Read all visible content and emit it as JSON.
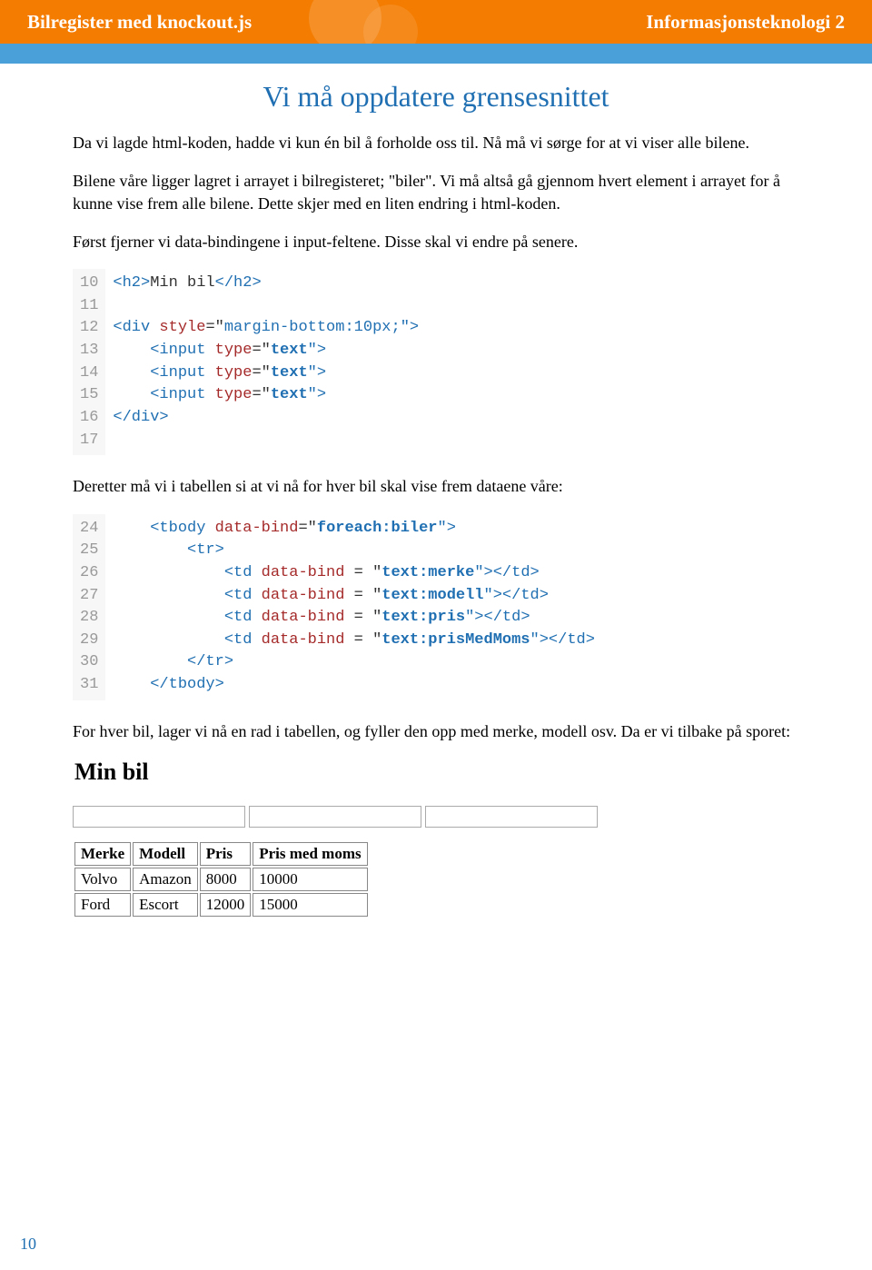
{
  "header": {
    "left": "Bilregister med knockout.js",
    "right": "Informasjonsteknologi 2"
  },
  "title": "Vi må oppdatere grensesnittet",
  "para1": "Da vi lagde html-koden, hadde vi kun én bil å forholde oss til. Nå må vi sørge for at vi viser alle bilene.",
  "para2": "Bilene våre ligger lagret i arrayet i bilregisteret; \"biler\". Vi må altså gå gjennom hvert element i arrayet for å kunne vise frem alle bilene. Dette skjer med en liten endring i html-koden.",
  "para3": "Først fjerner vi data-bindingene i input-feltene. Disse skal vi endre på senere.",
  "code1": {
    "lines": [
      "10",
      "11",
      "12",
      "13",
      "14",
      "15",
      "16",
      "17"
    ],
    "l10_open": "<h2>",
    "l10_text": "Min bil",
    "l10_close": "</h2>",
    "l12_a": "<div ",
    "l12_b": "style",
    "l12_c": "=\"",
    "l12_d": "margin-bottom:10px;",
    "l12_e": "\">",
    "l13_a": "<input ",
    "l13_b": "type",
    "l13_c": "=\"",
    "l13_d": "text",
    "l13_e": "\">",
    "l16": "</div>"
  },
  "para4": "Deretter må vi i tabellen si at vi nå for hver bil skal vise frem dataene våre:",
  "code2": {
    "lines": [
      "24",
      "25",
      "26",
      "27",
      "28",
      "29",
      "30",
      "31"
    ],
    "l24_a": "<tbody ",
    "l24_b": "data-bind",
    "l24_c": "=\"",
    "l24_d": "foreach:biler",
    "l24_e": "\">",
    "l25": "<tr>",
    "l26_a": "<td ",
    "l26_b": "data-bind",
    "l26_c": " = \"",
    "l26_d": "text:merke",
    "l26_e": "\"></td>",
    "l27_d": "text:modell",
    "l28_d": "text:pris",
    "l29_d": "text:prisMedMoms",
    "l30": "</tr>",
    "l31": "</tbody>"
  },
  "para5": "For hver bil, lager vi nå en rad i tabellen, og fyller den opp med merke, modell osv. Da er vi tilbake på sporet:",
  "example": {
    "heading": "Min bil",
    "columns": [
      "Merke",
      "Modell",
      "Pris",
      "Pris med moms"
    ],
    "rows": [
      [
        "Volvo",
        "Amazon",
        "8000",
        "10000"
      ],
      [
        "Ford",
        "Escort",
        "12000",
        "15000"
      ]
    ]
  },
  "pageNumber": "10"
}
